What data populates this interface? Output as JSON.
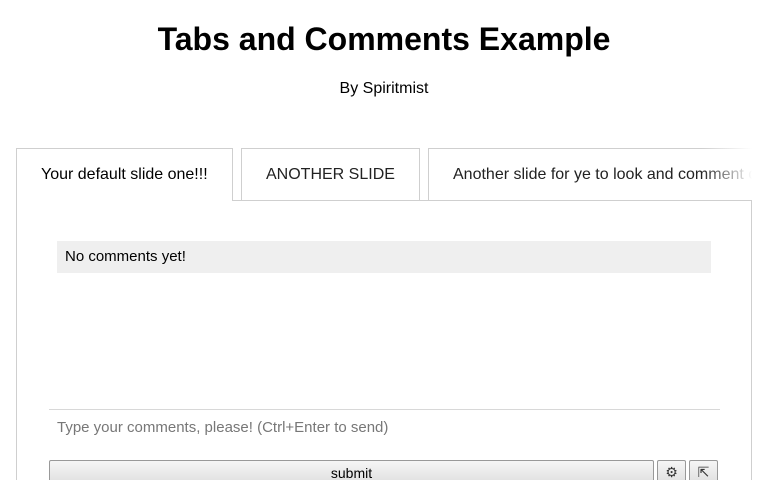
{
  "header": {
    "title": "Tabs and Comments Example",
    "byline": "By Spiritmist"
  },
  "tabs": [
    {
      "label": "Your default slide one!!!",
      "active": true
    },
    {
      "label": "ANOTHER SLIDE",
      "active": false
    },
    {
      "label": "Another slide for ye to look and comment on",
      "active": false
    }
  ],
  "comments": {
    "empty_message": "No comments yet!",
    "input_placeholder": "Type your comments, please! (Ctrl+Enter to send)",
    "input_value": "",
    "submit_label": "submit",
    "settings_icon": "⚙",
    "expand_icon": "⇱"
  },
  "icons": {
    "settings": "gear-icon",
    "expand": "expand-corner-icon"
  }
}
